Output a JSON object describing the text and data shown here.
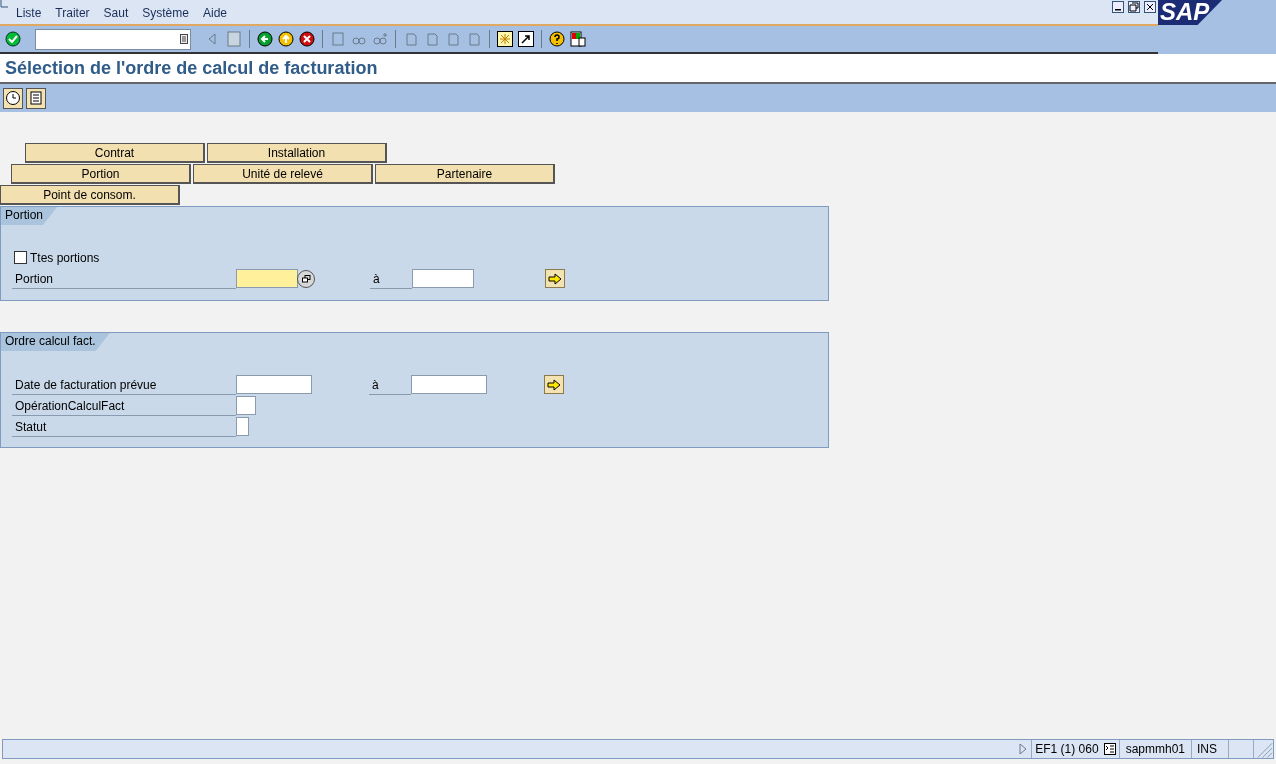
{
  "menu": [
    {
      "label": "Liste"
    },
    {
      "label": "Traiter"
    },
    {
      "label": "Saut"
    },
    {
      "label": "Système"
    },
    {
      "label": "Aide"
    }
  ],
  "logo": "SAP",
  "title": "Sélection de l'ordre de calcul de facturation",
  "tab_rows": [
    [
      {
        "label": "Contrat"
      },
      {
        "label": "Installation"
      }
    ],
    [
      {
        "label": "Portion"
      },
      {
        "label": "Unité de relevé"
      },
      {
        "label": "Partenaire"
      }
    ],
    [
      {
        "label": "Point de consom."
      }
    ]
  ],
  "sections": [
    {
      "title": "Portion",
      "rows": [
        {
          "kind": "checkbox",
          "label": "Ttes portions",
          "checked": false
        },
        {
          "kind": "range_help",
          "label": "Portion",
          "to_label": "à",
          "focused": true
        }
      ]
    },
    {
      "title": "Ordre calcul fact.",
      "rows": [
        {
          "kind": "range",
          "label": "Date de facturation prévue",
          "to_label": "à",
          "focused": false
        },
        {
          "kind": "flag",
          "label": "OpérationCalculFact",
          "focused": false
        },
        {
          "kind": "char",
          "label": "Statut",
          "focused": false
        }
      ]
    }
  ],
  "status_bar": {
    "system": "EF1 (1) 060",
    "server": "sapmmh01",
    "mode": "INS"
  }
}
